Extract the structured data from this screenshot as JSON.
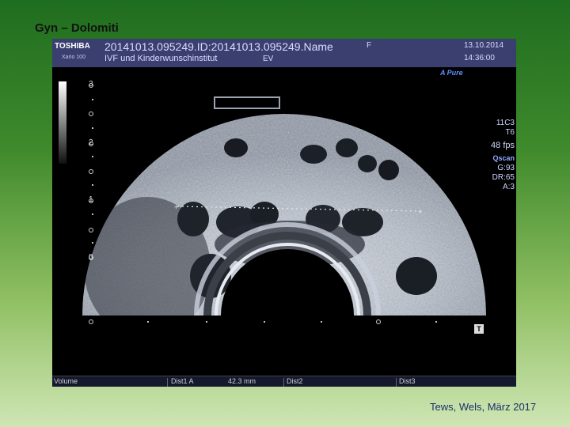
{
  "slide": {
    "title": "Gyn – Dolomiti",
    "credit": "Tews, Wels, März 2017"
  },
  "header": {
    "brand": "TOSHIBA",
    "model": "Xario 100",
    "study_id": "20141013.095249.ID:20141013.095249.Name",
    "institute": "IVF und Kinderwunschinstitut",
    "exam": "EV",
    "gender": "F",
    "date": "13.10.2014",
    "time": "14:36:00"
  },
  "mode_label": "A Pure",
  "params": {
    "probe": "11C3",
    "setting": "T6",
    "fps": "48 fps",
    "qscan": "Qscan",
    "gain": "G:93",
    "dr": "DR:65",
    "a": "A:3"
  },
  "depth_scale": [
    "3",
    "2",
    "1",
    "0"
  ],
  "orientation_marker": "T",
  "footer": {
    "volume": "Volume",
    "dist1": "Dist1 A",
    "dist1_value": "42.3 mm",
    "dist2": "Dist2",
    "dist3": "Dist3"
  },
  "colors": {
    "header_bg": "#3a3f70",
    "accent": "#5f8fff"
  }
}
